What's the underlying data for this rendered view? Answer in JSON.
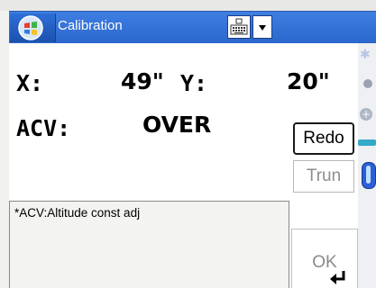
{
  "window": {
    "title": "Calibration",
    "start_icon": "windows-flag-icon",
    "keyboard_icon": "keyboard-icon",
    "dropdown_icon": "chevron-down-icon"
  },
  "readings": {
    "x_label": "X:",
    "x_value": "49\"",
    "y_label": "Y:",
    "y_value": "20\"",
    "acv_label": "ACV:",
    "acv_value": "OVER"
  },
  "buttons": {
    "redo": "Redo",
    "trun": "Trun",
    "ok": "OK"
  },
  "note": {
    "text": "*ACV:Altitude const adj"
  },
  "side_icons": [
    "sparkle-icon",
    "gear-icon",
    "plus-icon",
    "ruler-icon",
    "battery-icon"
  ],
  "colors": {
    "titlebar": "#2a66cc",
    "disabled_text": "#8e8e8e"
  }
}
